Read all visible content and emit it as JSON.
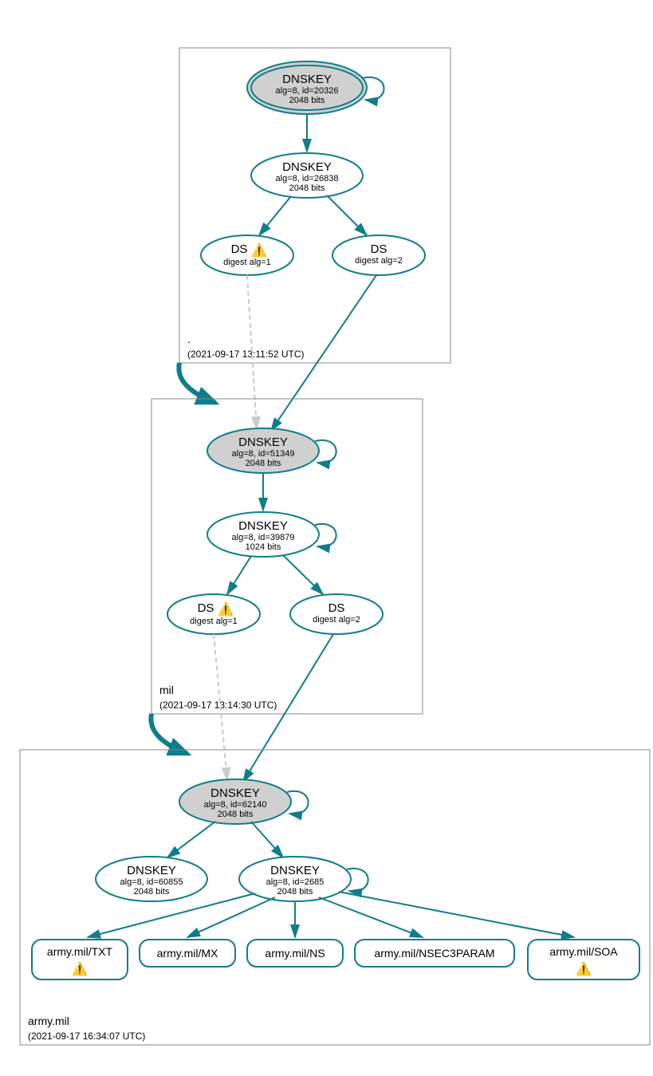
{
  "zones": {
    "root": {
      "label": ".",
      "timestamp": "(2021-09-17 13:11:52 UTC)",
      "ksk": {
        "title": "DNSKEY",
        "alg": "alg=8, id=20326",
        "bits": "2048 bits"
      },
      "zsk": {
        "title": "DNSKEY",
        "alg": "alg=8, id=26838",
        "bits": "2048 bits"
      },
      "ds1": {
        "title": "DS",
        "digest": "digest alg=1",
        "warn": "⚠️"
      },
      "ds2": {
        "title": "DS",
        "digest": "digest alg=2"
      }
    },
    "mil": {
      "label": "mil",
      "timestamp": "(2021-09-17 13:14:30 UTC)",
      "ksk": {
        "title": "DNSKEY",
        "alg": "alg=8, id=51349",
        "bits": "2048 bits"
      },
      "zsk": {
        "title": "DNSKEY",
        "alg": "alg=8, id=39879",
        "bits": "1024 bits"
      },
      "ds1": {
        "title": "DS",
        "digest": "digest alg=1",
        "warn": "⚠️"
      },
      "ds2": {
        "title": "DS",
        "digest": "digest alg=2"
      }
    },
    "army": {
      "label": "army.mil",
      "timestamp": "(2021-09-17 16:34:07 UTC)",
      "ksk": {
        "title": "DNSKEY",
        "alg": "alg=8, id=62140",
        "bits": "2048 bits"
      },
      "zsk1": {
        "title": "DNSKEY",
        "alg": "alg=8, id=60855",
        "bits": "2048 bits"
      },
      "zsk2": {
        "title": "DNSKEY",
        "alg": "alg=8, id=2685",
        "bits": "2048 bits"
      },
      "records": {
        "txt": {
          "label": "army.mil/TXT",
          "warn": "⚠️"
        },
        "mx": {
          "label": "army.mil/MX"
        },
        "ns": {
          "label": "army.mil/NS"
        },
        "nsec3": {
          "label": "army.mil/NSEC3PARAM"
        },
        "soa": {
          "label": "army.mil/SOA",
          "warn": "⚠️"
        }
      }
    }
  }
}
